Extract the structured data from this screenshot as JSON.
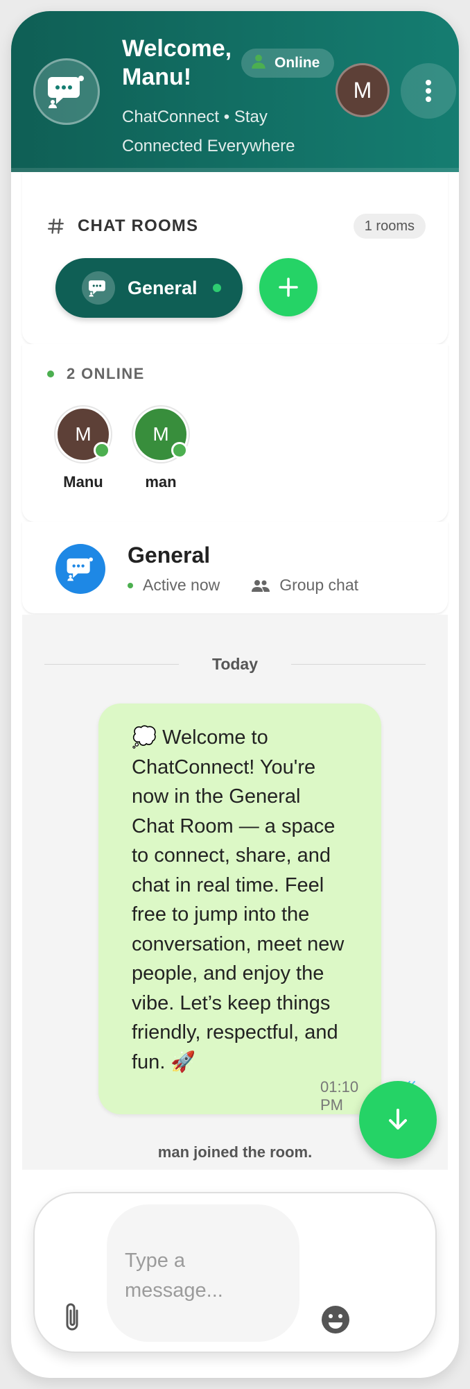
{
  "header": {
    "welcome": "Welcome, Manu!",
    "status": "Online",
    "subtitle": "ChatConnect • Stay Connected Everywhere",
    "avatar_initial": "M",
    "colors": {
      "gradient_start": "#0f5f55",
      "gradient_end": "#157d71"
    }
  },
  "rooms": {
    "title": "CHAT ROOMS",
    "count": "1 rooms",
    "items": [
      {
        "label": "General",
        "active": true
      }
    ],
    "add_icon": "plus-icon"
  },
  "online": {
    "title": "2 ONLINE",
    "users": [
      {
        "initial": "M",
        "name": "Manu",
        "color": "#5d4037"
      },
      {
        "initial": "M",
        "name": "man",
        "color": "#388e3c"
      }
    ]
  },
  "room_info": {
    "name": "General",
    "status": "Active now",
    "type": "Group chat"
  },
  "chat": {
    "day_label": "Today",
    "messages": [
      {
        "text": "💭 Welcome to ChatConnect! You're now in the General Chat Room — a space to connect, share, and chat in real time. Feel free to jump into the conversation, meet new people, and enjoy the vibe. Let’s keep things friendly, respectful, and fun. 🚀",
        "time": "01:10 PM",
        "read": true
      }
    ],
    "system_message": "man joined the room."
  },
  "composer": {
    "placeholder": "Type a message...",
    "value": ""
  },
  "colors": {
    "accent": "#25d366",
    "online": "#4caf50",
    "bubble": "#dcf8c6",
    "room_avatar": "#1e88e5"
  }
}
